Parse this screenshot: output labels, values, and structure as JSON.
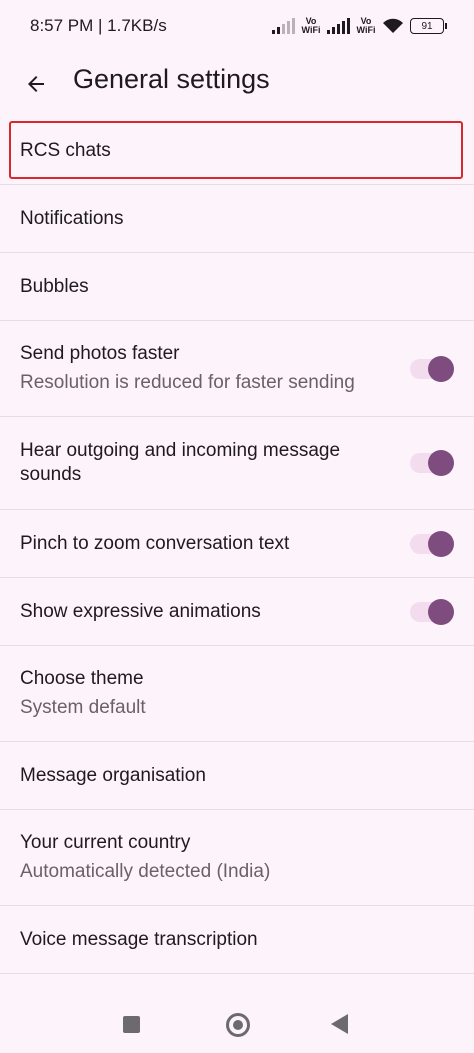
{
  "status_bar": {
    "time_speed": "8:57 PM | 1.7KB/s",
    "volte_1": "Vo WiFi",
    "volte_2": "Vo WiFi",
    "battery": "91"
  },
  "header": {
    "title": "General settings",
    "back_icon": "arrow-back-icon"
  },
  "settings": [
    {
      "title": "RCS chats"
    },
    {
      "title": "Notifications"
    },
    {
      "title": "Bubbles"
    },
    {
      "title": "Send photos faster",
      "subtitle": "Resolution is reduced for faster sending",
      "toggle": true
    },
    {
      "title": "Hear outgoing and incoming message sounds",
      "toggle": true
    },
    {
      "title": "Pinch to zoom conversation text",
      "toggle": true
    },
    {
      "title": "Show expressive animations",
      "toggle": true
    },
    {
      "title": "Choose theme",
      "subtitle": "System default"
    },
    {
      "title": "Message organisation"
    },
    {
      "title": "Your current country",
      "subtitle": "Automatically detected (India)"
    },
    {
      "title": "Voice message transcription"
    }
  ],
  "colors": {
    "background": "#fcf4fa",
    "toggle_knob": "#7e4c7f",
    "toggle_track": "#f2dced",
    "highlight": "#d9272e"
  },
  "nav_bar": {
    "recents_icon": "square-icon",
    "home_icon": "circle-home-icon",
    "back_icon": "triangle-back-icon"
  }
}
